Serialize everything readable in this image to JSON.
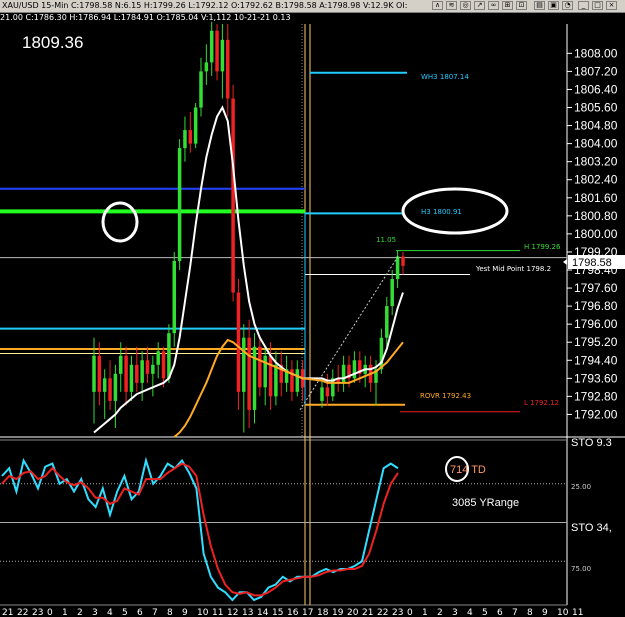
{
  "window": {
    "title": "XAU/USD  15-Min  C:1798.58  N:6.15  H:1799.26  L:1792.12  O:1792.62  B:1798.58  A:1798.98  V:12.9K  OI:",
    "subtitle": "21.00  C:1786.30  H:1786.94  L:1784.91  O:1785.04  V:1,112  10-21-21  0.13"
  },
  "colors": {
    "background": "#000000",
    "candle_up": "#33dd33",
    "candle_down": "#ee2222",
    "ma_white": "#ffffff",
    "ma_orange": "#ffaa22",
    "level_cyan": "#22ccff",
    "level_blue": "#2244ff",
    "level_green": "#22ff22",
    "stoch_cyan": "#33ddff",
    "stoch_red": "#ee2222",
    "separator": "#ffcc66"
  },
  "chart_data": [
    {
      "type": "candlestick",
      "title": "1809.36",
      "price_axis_ticks": [
        "1808.00",
        "1807.20",
        "1806.40",
        "1805.60",
        "1804.80",
        "1804.00",
        "1803.20",
        "1802.40",
        "1801.60",
        "1800.80",
        "1800.00",
        "1799.20",
        "1798.40",
        "1797.60",
        "1796.80",
        "1796.00",
        "1795.20",
        "1794.40",
        "1793.60",
        "1792.80",
        "1792.00"
      ],
      "last_price": "1798.58",
      "ylim": [
        1791.0,
        1809.3
      ],
      "levels": [
        {
          "label": "WH3 1807.14",
          "value": 1807.14
        },
        {
          "label": "H3  1800.91",
          "value": 1800.91
        },
        {
          "label": "H  1799.26",
          "value": 1799.26
        },
        {
          "label": "Yest Mid Point  1798.2",
          "value": 1798.2
        },
        {
          "label": "ROVR  1792.43",
          "value": 1792.43
        },
        {
          "label": "L  1792.12",
          "value": 1792.12
        },
        {
          "label": "",
          "value": 1802.0
        },
        {
          "label": "",
          "value": 1801.0
        },
        {
          "label": "",
          "value": 1795.8
        },
        {
          "label": "",
          "value": 1794.9
        },
        {
          "label": "",
          "value": 1794.7
        }
      ],
      "range_label": "11.05",
      "candles_day1": [
        [
          1793.0,
          1795.4,
          1791.6,
          1794.6
        ],
        [
          1794.6,
          1795.2,
          1792.4,
          1793.0
        ],
        [
          1793.0,
          1794.0,
          1791.8,
          1793.6
        ],
        [
          1793.6,
          1794.4,
          1792.2,
          1792.6
        ],
        [
          1792.6,
          1794.2,
          1791.4,
          1793.8
        ],
        [
          1793.8,
          1795.2,
          1793.0,
          1794.6
        ],
        [
          1794.6,
          1795.0,
          1792.4,
          1793.0
        ],
        [
          1793.0,
          1794.6,
          1792.6,
          1794.2
        ],
        [
          1794.2,
          1795.0,
          1793.0,
          1793.4
        ],
        [
          1793.4,
          1794.8,
          1792.6,
          1794.4
        ],
        [
          1794.4,
          1795.0,
          1793.4,
          1793.8
        ],
        [
          1793.8,
          1794.6,
          1792.8,
          1794.2
        ],
        [
          1794.2,
          1795.2,
          1793.6,
          1794.8
        ],
        [
          1794.8,
          1795.0,
          1793.2,
          1793.6
        ],
        [
          1793.6,
          1796.0,
          1793.4,
          1795.6
        ],
        [
          1795.6,
          1799.2,
          1795.0,
          1798.8
        ],
        [
          1798.8,
          1804.2,
          1798.4,
          1803.8
        ],
        [
          1803.8,
          1805.2,
          1803.2,
          1804.6
        ],
        [
          1804.6,
          1805.4,
          1803.6,
          1804.0
        ],
        [
          1804.0,
          1805.8,
          1803.8,
          1805.6
        ],
        [
          1805.6,
          1807.8,
          1805.2,
          1807.2
        ],
        [
          1807.2,
          1808.4,
          1806.6,
          1807.6
        ],
        [
          1807.6,
          1809.4,
          1807.0,
          1809.0
        ],
        [
          1809.0,
          1809.3,
          1806.8,
          1807.2
        ],
        [
          1807.2,
          1809.3,
          1806.0,
          1808.6
        ],
        [
          1808.6,
          1809.3,
          1805.2,
          1806.0
        ],
        [
          1806.0,
          1806.6,
          1797.0,
          1797.4
        ],
        [
          1797.4,
          1798.0,
          1792.2,
          1793.0
        ],
        [
          1793.0,
          1796.0,
          1791.2,
          1795.4
        ],
        [
          1795.4,
          1796.2,
          1791.4,
          1792.2
        ],
        [
          1792.2,
          1795.6,
          1791.6,
          1795.0
        ],
        [
          1795.0,
          1795.4,
          1792.8,
          1793.2
        ],
        [
          1793.2,
          1795.0,
          1792.4,
          1794.6
        ],
        [
          1794.6,
          1795.2,
          1792.2,
          1792.8
        ],
        [
          1792.8,
          1794.8,
          1792.4,
          1794.2
        ],
        [
          1794.2,
          1794.8,
          1792.8,
          1793.4
        ],
        [
          1793.4,
          1794.6,
          1793.0,
          1794.0
        ],
        [
          1794.0,
          1794.4,
          1792.6,
          1793.0
        ],
        [
          1793.0,
          1794.4,
          1792.8,
          1794.0
        ],
        [
          1794.0,
          1794.4,
          1792.6,
          1793.2
        ]
      ],
      "candles_day2": [
        [
          1792.6,
          1793.6,
          1792.3,
          1793.2
        ],
        [
          1793.2,
          1793.8,
          1792.4,
          1792.8
        ],
        [
          1792.8,
          1794.0,
          1792.6,
          1793.6
        ],
        [
          1793.6,
          1794.2,
          1793.0,
          1793.4
        ],
        [
          1793.4,
          1794.6,
          1793.0,
          1794.2
        ],
        [
          1794.2,
          1794.6,
          1793.2,
          1793.6
        ],
        [
          1793.6,
          1794.8,
          1793.4,
          1794.4
        ],
        [
          1794.4,
          1794.8,
          1793.4,
          1793.8
        ],
        [
          1793.8,
          1794.6,
          1793.2,
          1794.2
        ],
        [
          1794.2,
          1794.6,
          1793.0,
          1793.4
        ],
        [
          1793.4,
          1794.4,
          1792.4,
          1794.0
        ],
        [
          1794.0,
          1795.8,
          1793.8,
          1795.4
        ],
        [
          1795.4,
          1797.2,
          1795.0,
          1796.8
        ],
        [
          1796.8,
          1798.4,
          1796.4,
          1798.0
        ],
        [
          1798.0,
          1799.26,
          1797.6,
          1799.0
        ],
        [
          1799.0,
          1799.2,
          1798.2,
          1798.58
        ]
      ],
      "ma_white": [
        1791.2,
        1791.4,
        1791.6,
        1791.8,
        1792.0,
        1792.3,
        1792.5,
        1792.7,
        1792.9,
        1793.0,
        1793.1,
        1793.2,
        1793.3,
        1793.4,
        1793.6,
        1794.2,
        1795.4,
        1797.0,
        1798.6,
        1800.4,
        1802.0,
        1803.4,
        1804.4,
        1805.2,
        1805.6,
        1805.0,
        1803.0,
        1800.6,
        1798.6,
        1797.0,
        1796.0,
        1795.4,
        1795.0,
        1794.6,
        1794.3,
        1794.1,
        1793.9,
        1793.8,
        1793.7,
        1793.6,
        1793.6,
        1793.5,
        1793.5,
        1793.6,
        1793.6,
        1793.7,
        1793.8,
        1793.9,
        1794.0,
        1794.0,
        1794.1,
        1794.3,
        1794.9,
        1795.8,
        1796.7,
        1797.4
      ],
      "ma_orange": [
        null,
        null,
        null,
        null,
        null,
        null,
        null,
        null,
        null,
        null,
        null,
        null,
        null,
        null,
        null,
        1791.0,
        1791.2,
        1791.5,
        1791.9,
        1792.4,
        1792.9,
        1793.4,
        1794.0,
        1794.6,
        1795.0,
        1795.3,
        1795.2,
        1795.0,
        1794.8,
        1794.6,
        1794.5,
        1794.4,
        1794.3,
        1794.2,
        1794.1,
        1794.0,
        1793.9,
        1793.8,
        1793.7,
        1793.6,
        1793.5,
        1793.4,
        1793.4,
        1793.4,
        1793.4,
        1793.4,
        1793.5,
        1793.6,
        1793.7,
        1793.8,
        1793.9,
        1794.1,
        1794.3,
        1794.6,
        1794.9,
        1795.2
      ]
    },
    {
      "type": "line",
      "title": "STO",
      "labels": {
        "top": "STO  9.3",
        "mid": "STO  34,"
      },
      "td_label": "714 TD",
      "yrange_label": "3085 YRange",
      "ticks": [
        "25.00",
        "75.00"
      ],
      "ylim": [
        0,
        100
      ],
      "series": [
        {
          "name": "",
          "values": [
            20,
            15,
            30,
            10,
            18,
            28,
            14,
            12,
            25,
            22,
            30,
            22,
            35,
            40,
            28,
            45,
            30,
            20,
            35,
            30,
            10,
            25,
            20,
            12,
            15,
            10,
            18,
            28,
            70,
            85,
            92,
            95,
            100,
            95,
            95,
            100,
            98,
            92,
            90,
            85,
            88,
            85,
            85,
            85,
            82,
            80,
            82,
            80,
            80,
            78,
            75,
            55,
            35,
            15,
            12,
            15
          ]
        },
        {
          "name": "",
          "values": [
            25,
            20,
            22,
            18,
            17,
            22,
            20,
            15,
            20,
            24,
            26,
            24,
            28,
            34,
            34,
            38,
            36,
            28,
            30,
            32,
            22,
            22,
            22,
            18,
            15,
            12,
            14,
            20,
            45,
            65,
            80,
            90,
            95,
            96,
            95,
            97,
            97,
            95,
            92,
            88,
            87,
            86,
            85,
            85,
            84,
            82,
            81,
            81,
            80,
            80,
            78,
            70,
            55,
            38,
            25,
            18
          ]
        }
      ],
      "xticks": [
        "21",
        "22",
        "23",
        "0",
        "1",
        "2",
        "3",
        "4",
        "5",
        "6",
        "7",
        "8",
        "9",
        "10",
        "11",
        "12",
        "13",
        "14",
        "15",
        "16",
        "17",
        "18",
        "19",
        "20",
        "21",
        "22",
        "23",
        "0",
        "1",
        "2",
        "3",
        "4",
        "5",
        "6",
        "7",
        "8",
        "9",
        "10",
        "11"
      ]
    }
  ]
}
